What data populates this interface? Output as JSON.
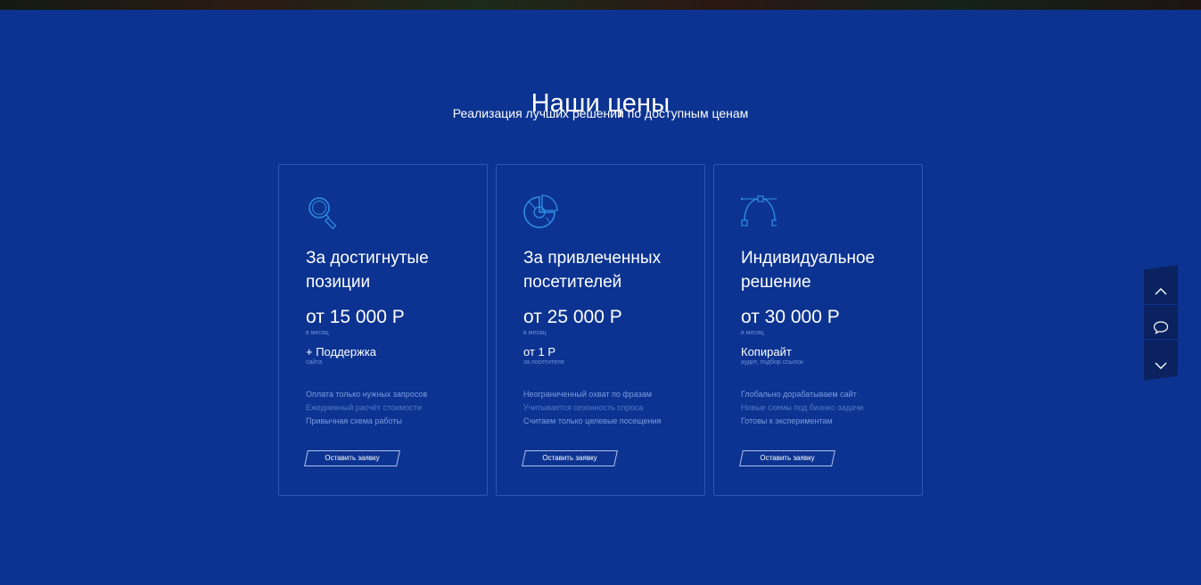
{
  "header": {
    "title": "Наши цены",
    "subtitle": "Реализация лучших решений по доступным ценам"
  },
  "colors": {
    "background": "#0c3391",
    "icon_stroke": "#2f8fe6",
    "muted_text": "#7d9be0"
  },
  "cards": [
    {
      "icon": "search-icon",
      "name": "За достигнутые позиции",
      "price": "от 15 000 Р",
      "price_note": "в месяц",
      "extra": "+ Поддержка",
      "extra_note": "сайта",
      "features": [
        "Оплата только нужных запросов",
        "Ежедневный расчёт стоимости",
        "Привычная схема работы"
      ],
      "cta": "Оставить заявку"
    },
    {
      "icon": "pie-chart-icon",
      "name": "За привлеченных посетителей",
      "price": "от 25 000 Р",
      "price_note": "в месяц",
      "extra": "от 1 Р",
      "extra_note": "за посетителя",
      "features": [
        "Неограниченный охват по фразам",
        "Учитывается сезонность спроса",
        "Считаем только целевые посещения"
      ],
      "cta": "Оставить заявку"
    },
    {
      "icon": "bezier-pen-icon",
      "name": "Индивидуальное решение",
      "price": "от 30 000 Р",
      "price_note": "в месяц",
      "extra": "Копирайт",
      "extra_note": "аудит, подбор ссылок",
      "features": [
        "Глобально дорабатываем сайт",
        "Новые схемы под бизнес-задачи",
        "Готовы к экспериментам"
      ],
      "cta": "Оставить заявку"
    }
  ],
  "side_nav": {
    "up_icon": "chevron-up-icon",
    "chat_icon": "chat-bubble-icon",
    "down_icon": "chevron-down-icon"
  }
}
